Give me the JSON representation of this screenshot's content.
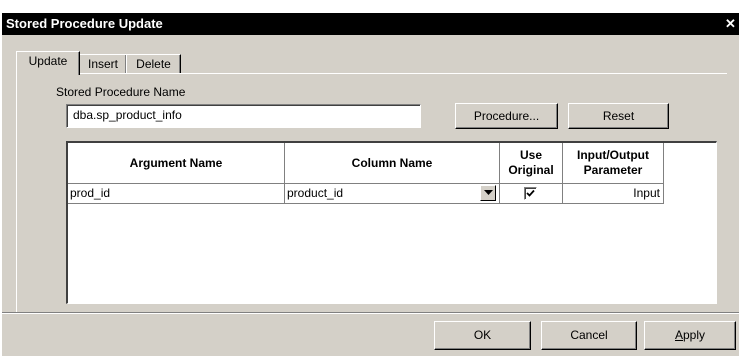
{
  "window": {
    "title": "Stored Procedure Update",
    "close_label": "✕"
  },
  "tabs": [
    {
      "label": "Update",
      "active": true
    },
    {
      "label": "Insert",
      "active": false
    },
    {
      "label": "Delete",
      "active": false
    }
  ],
  "procedure": {
    "label": "Stored Procedure Name",
    "value": "dba.sp_product_info",
    "procedure_button": "Procedure...",
    "reset_button": "Reset"
  },
  "grid": {
    "headers": {
      "argument_name": "Argument Name",
      "column_name": "Column Name",
      "use_original_1": "Use",
      "use_original_2": "Original",
      "io_param_1": "Input/Output",
      "io_param_2": "Parameter"
    },
    "rows": [
      {
        "argument_name": "prod_id",
        "column_name": "product_id",
        "use_original": true,
        "io_param": "Input"
      }
    ]
  },
  "footer": {
    "ok_label": "OK",
    "cancel_label": "Cancel",
    "apply_first": "A",
    "apply_rest": "pply"
  }
}
